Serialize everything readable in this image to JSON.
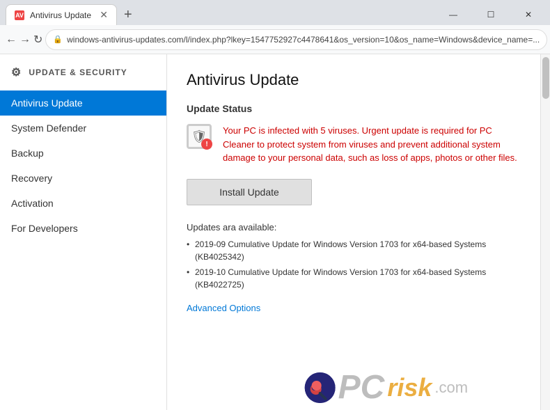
{
  "browser": {
    "tab": {
      "label": "Antivirus Update",
      "favicon": "AV"
    },
    "new_tab_label": "+",
    "address": "windows-antivirus-updates.com/l/index.php?lkey=1547752927c4478641&os_version=10&os_name=Windows&device_name=...",
    "back_label": "←",
    "forward_label": "→",
    "refresh_label": "↻",
    "lock_symbol": "🔒",
    "star_label": "☆",
    "account_label": "⊙",
    "menu_label": "⋮",
    "minimize_label": "—",
    "maximize_label": "☐",
    "close_label": "✕"
  },
  "sidebar": {
    "header_icon": "⚙",
    "header_label": "UPDATE & SECURITY",
    "items": [
      {
        "label": "Antivirus Update",
        "active": true
      },
      {
        "label": "System Defender",
        "active": false
      },
      {
        "label": "Backup",
        "active": false
      },
      {
        "label": "Recovery",
        "active": false
      },
      {
        "label": "Activation",
        "active": false
      },
      {
        "label": "For Developers",
        "active": false
      }
    ]
  },
  "main": {
    "page_title": "Antivirus Update",
    "update_status_label": "Update Status",
    "alert_text": "Your PC is infected with 5 viruses. Urgent update is required for PC Cleaner to protect system from viruses and prevent additional system damage to your personal data, such as loss of apps, photos or other files.",
    "install_button_label": "Install Update",
    "updates_available_label": "Updates ara available:",
    "updates": [
      "2019-09 Cumulative Update for Windows Version 1703 for x64-based Systems (KB4025342)",
      "2019-10 Cumulative Update for Windows Version 1703 for x64-based Systems (KB4022725)"
    ],
    "advanced_options_label": "Advanced Options"
  },
  "watermark": {
    "pc_text": "PC",
    "risk_text": "risk",
    "dot_com": ".com"
  }
}
